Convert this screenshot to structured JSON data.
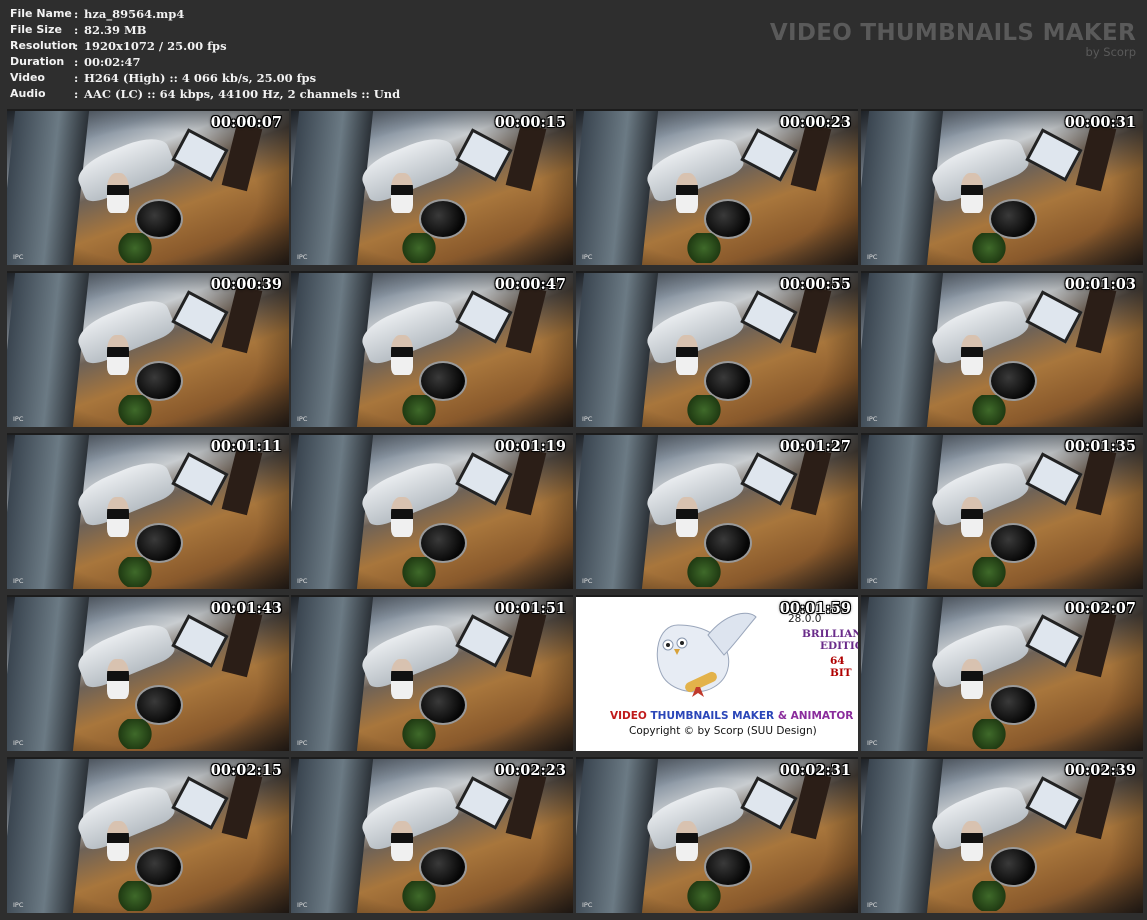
{
  "meta": [
    {
      "key": "File Name",
      "value": "hza_89564.mp4"
    },
    {
      "key": "File Size",
      "value": "82.39 MB"
    },
    {
      "key": "Resolution",
      "value": "1920x1072 / 25.00 fps"
    },
    {
      "key": "Duration",
      "value": "00:02:47"
    },
    {
      "key": "Video",
      "value": "H264 (High) :: 4 066 kb/s, 25.00 fps"
    },
    {
      "key": "Audio",
      "value": "AAC (LC) :: 64 kbps, 44100 Hz, 2 channels :: Und"
    }
  ],
  "separator": ":",
  "brand": {
    "title": "VIDEO THUMBNAILS MAKER",
    "subtitle": "by Scorp"
  },
  "frame_overlay": {
    "corner_label": "IPC"
  },
  "thumbnails": [
    {
      "time": "00:00:07"
    },
    {
      "time": "00:00:15"
    },
    {
      "time": "00:00:23"
    },
    {
      "time": "00:00:31"
    },
    {
      "time": "00:00:39"
    },
    {
      "time": "00:00:47"
    },
    {
      "time": "00:00:55"
    },
    {
      "time": "00:01:03"
    },
    {
      "time": "00:01:11"
    },
    {
      "time": "00:01:19"
    },
    {
      "time": "00:01:27"
    },
    {
      "time": "00:01:35"
    },
    {
      "time": "00:01:43"
    },
    {
      "time": "00:01:51"
    },
    {
      "time": "00:01:59",
      "logo": true
    },
    {
      "time": "00:02:07"
    },
    {
      "time": "00:02:15"
    },
    {
      "time": "00:02:23"
    },
    {
      "time": "00:02:31"
    },
    {
      "time": "00:02:39"
    }
  ],
  "logo_frame": {
    "version": "28.0.0",
    "edition_1": "BRILLIANCE",
    "edition_2": "EDITION",
    "edition_3": "64 BIT",
    "name_a": "VIDEO",
    "name_b": "THUMBNAILS MAKER",
    "name_c": "& ANIMATOR",
    "copyright": "Copyright © by Scorp (SUU Design)"
  },
  "colors": {
    "background": "#2e2e2e",
    "meta_text": "#f2f2f2",
    "brand_text": "#5a5a5a"
  }
}
